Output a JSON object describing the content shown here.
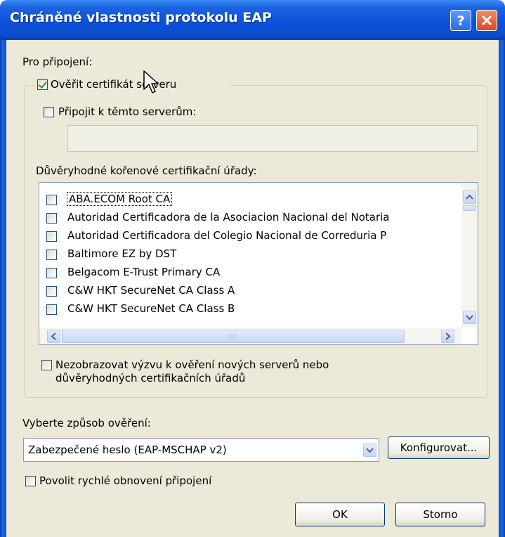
{
  "window": {
    "title": "Chráněné vlastnosti protokolu EAP",
    "help_button": "?",
    "close_button": "×"
  },
  "connection": {
    "section_label": "Pro připojení:",
    "verify_cert_label": "Ověřit certifikát serveru",
    "verify_cert_checked": true,
    "connect_servers_label": "Připojit k těmto serverům:",
    "connect_servers_checked": false,
    "servers_value": "",
    "trusted_ca_label": "Důvěryhodné kořenové certifikační úřady:",
    "ca_list": [
      {
        "label": "ABA.ECOM Root CA",
        "checked": false
      },
      {
        "label": "Autoridad Certificadora de la Asociacion Nacional del Notaria",
        "checked": false
      },
      {
        "label": "Autoridad Certificadora del Colegio Nacional de Correduria P",
        "checked": false
      },
      {
        "label": "Baltimore EZ by DST",
        "checked": false
      },
      {
        "label": "Belgacom E-Trust Primary CA",
        "checked": false
      },
      {
        "label": "C&W HKT SecureNet CA Class A",
        "checked": false
      },
      {
        "label": "C&W HKT SecureNet CA Class B",
        "checked": false
      }
    ],
    "no_prompt_label_line1": "Nezobrazovat výzvu k ověření nových serverů nebo",
    "no_prompt_label_line2": "důvěryhodných certifikačních úřadů",
    "no_prompt_checked": false
  },
  "auth": {
    "method_label": "Vyberte způsob ověření:",
    "method_value": "Zabezpečené heslo (EAP-MSCHAP v2)",
    "configure_button": "Konfigurovat...",
    "fast_reconnect_label": "Povolit rychlé obnovení připojení",
    "fast_reconnect_checked": false
  },
  "buttons": {
    "ok": "OK",
    "cancel": "Storno"
  }
}
